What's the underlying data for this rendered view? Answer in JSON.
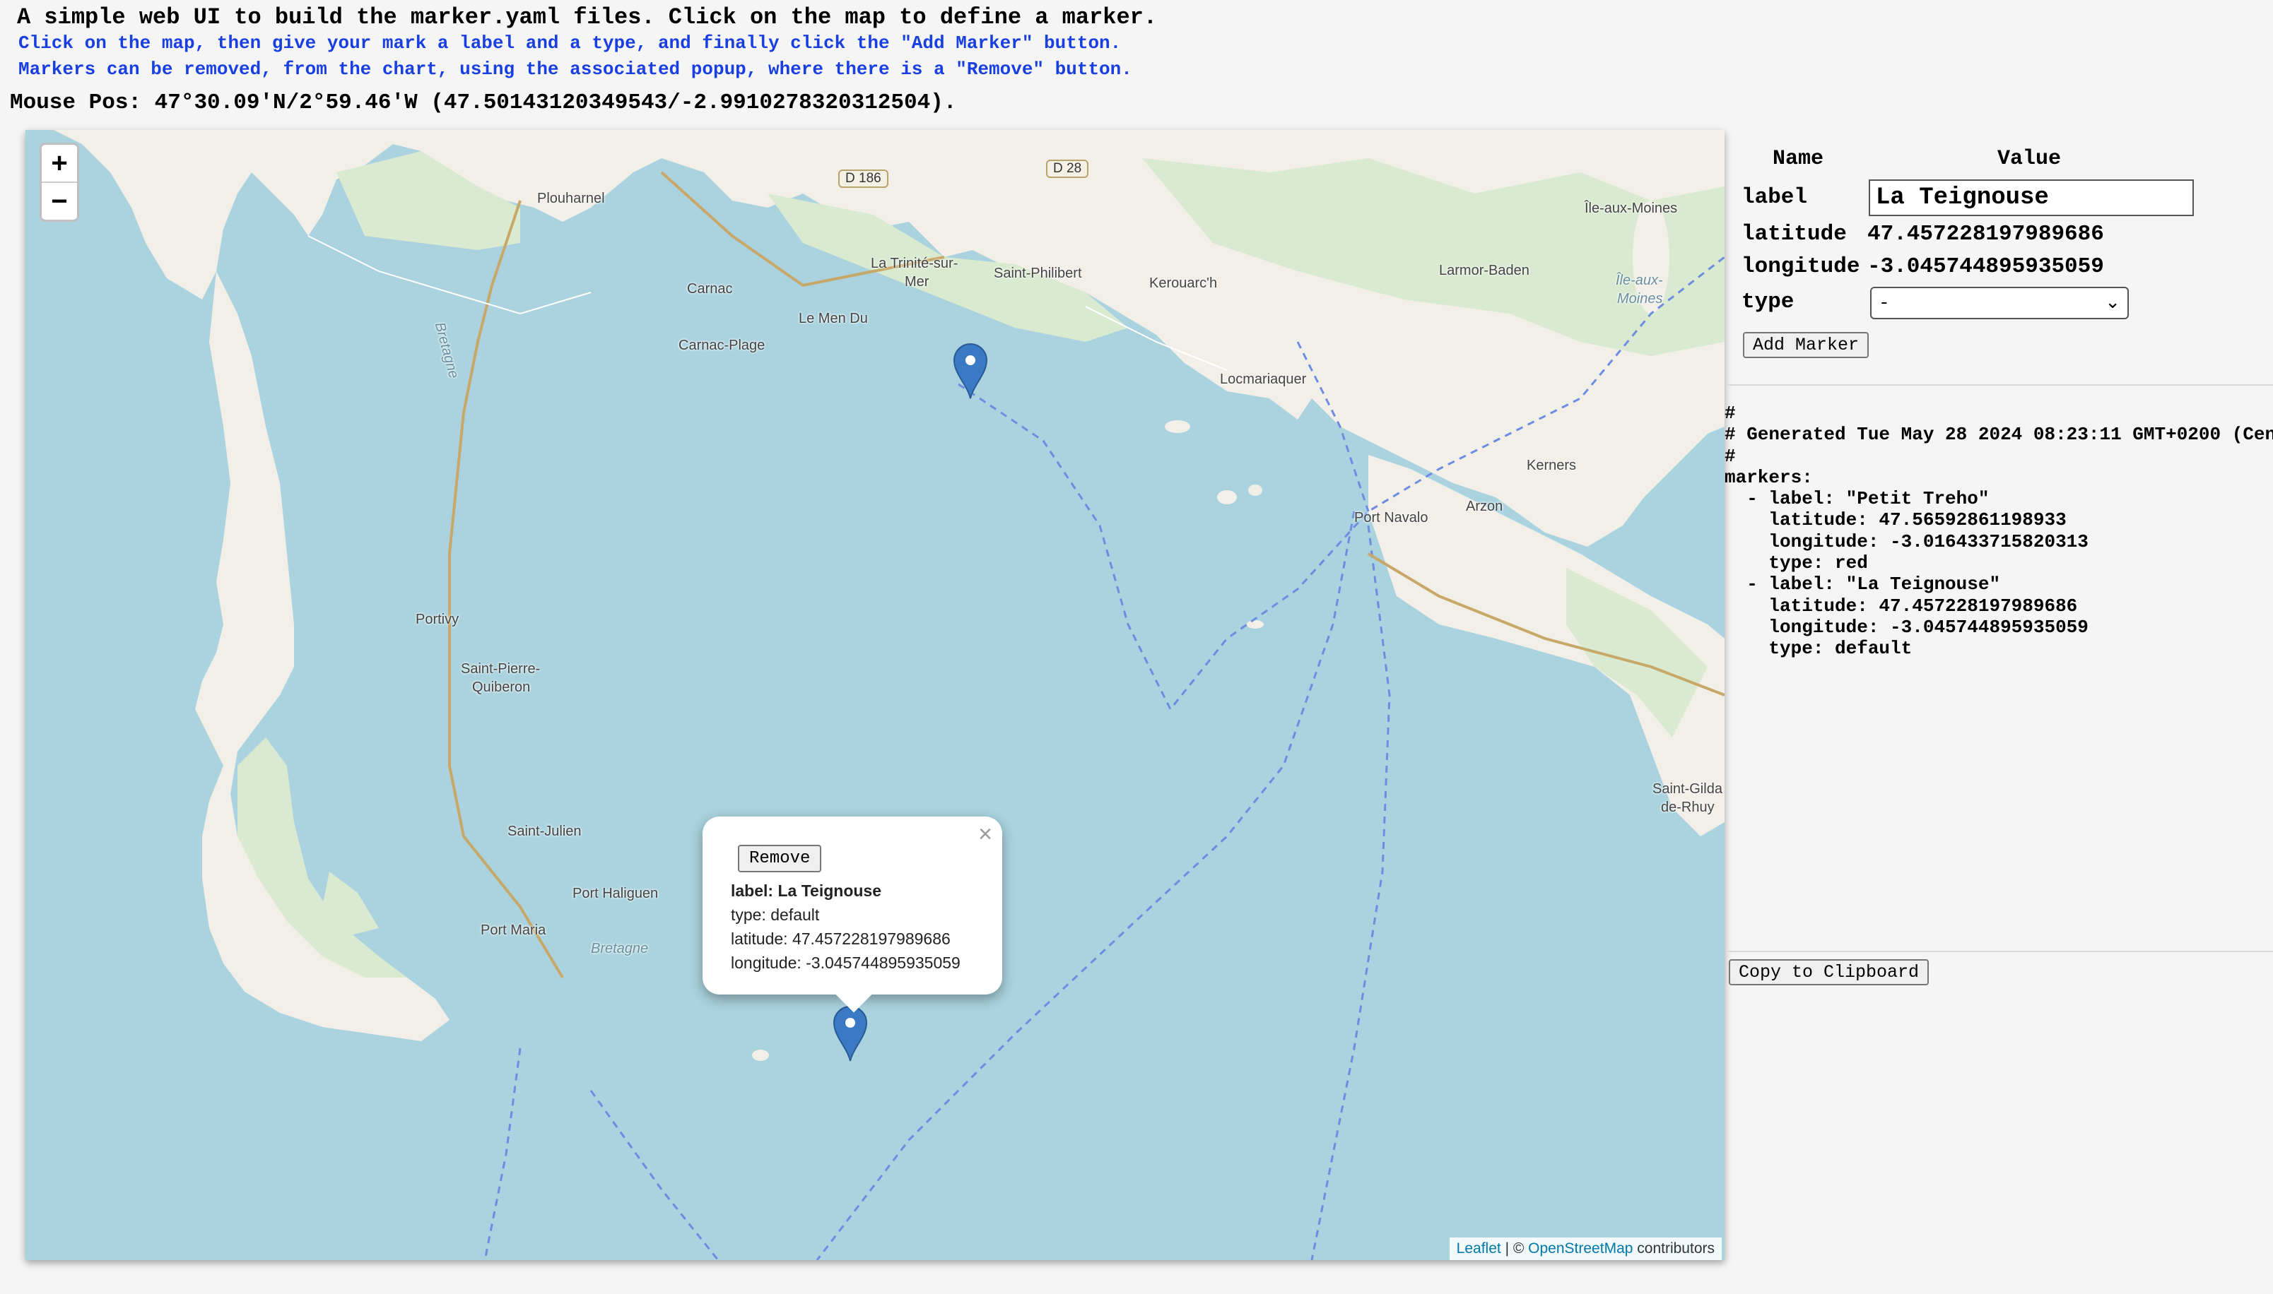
{
  "header": {
    "title": "A simple web UI to build the marker.yaml files. Click on the map to define a marker.",
    "instruction_1": "Click on the map, then give your mark a label and a type, and finally click the \"Add Marker\" button.",
    "instruction_2": "Markers can be removed, from the chart, using the associated popup, where there is a \"Remove\" button.",
    "mouse_pos": "Mouse Pos: 47°30.09'N/2°59.46'W (47.50143120349543/-2.9910278320312504)."
  },
  "map": {
    "zoom_in": "+",
    "zoom_out": "−",
    "places": {
      "plouharnel": "Plouharnel",
      "d186": "D 186",
      "d28": "D 28",
      "la_trinite_1": "La Trinité-sur-",
      "la_trinite_2": "Mer",
      "carnac": "Carnac",
      "saint_philibert": "Saint-Philibert",
      "kerouarch": "Kerouarc'h",
      "larmor_baden": "Larmor-Baden",
      "ile_aux_moines": "Île-aux-Moines",
      "ile_aux_moines_2a": "Île-aux-",
      "ile_aux_moines_2b": "Moines",
      "le_men_du": "Le Men Du",
      "carnac_plage": "Carnac-Plage",
      "locmariaquer": "Locmariaquer",
      "kerners": "Kerners",
      "port_navalo": "Port Navalo",
      "arzon": "Arzon",
      "portivy": "Portivy",
      "saint_pierre_1": "Saint-Pierre-",
      "saint_pierre_2": "Quiberon",
      "saint_julien": "Saint-Julien",
      "port_haliguen": "Port Haliguen",
      "port_maria": "Port Maria",
      "bretagne_1": "Bretagne",
      "bretagne_2": "Bretagne",
      "saint_gildas_1": "Saint-Gilda",
      "saint_gildas_2": "de-Rhuy"
    },
    "popup": {
      "close": "×",
      "remove_label": "Remove",
      "label_line": "label: La Teignouse",
      "type_line": "type: default",
      "latitude_line": "latitude: 47.457228197989686",
      "longitude_line": "longitude: -3.045744895935059"
    },
    "attribution": {
      "leaflet": "Leaflet",
      "separator": " | © ",
      "osm": "OpenStreetMap",
      "contributors": " contributors"
    },
    "marker_color": "#3a7ac4"
  },
  "form": {
    "col_name": "Name",
    "col_value": "Value",
    "label_key": "label",
    "label_value": "La Teignouse",
    "latitude_key": "latitude",
    "latitude_value": "47.457228197989686",
    "longitude_key": "longitude",
    "longitude_value": "-3.045744895935059",
    "type_key": "type",
    "type_selected": "-",
    "add_marker_label": "Add Marker"
  },
  "yaml_output": "#\n# Generated Tue May 28 2024 08:23:11 GMT+0200 (Cen\n#\nmarkers:\n  - label: \"Petit Treho\"\n    latitude: 47.56592861198933\n    longitude: -3.016433715820313\n    type: red\n  - label: \"La Teignouse\"\n    latitude: 47.457228197989686\n    longitude: -3.045744895935059\n    type: default",
  "copy_label": "Copy to Clipboard",
  "colors": {
    "instruction_text": "#1a3fe0",
    "sea": "#aad3df",
    "land": "#f2efe9",
    "green": "#d9ead0",
    "link": "#0078a8"
  }
}
